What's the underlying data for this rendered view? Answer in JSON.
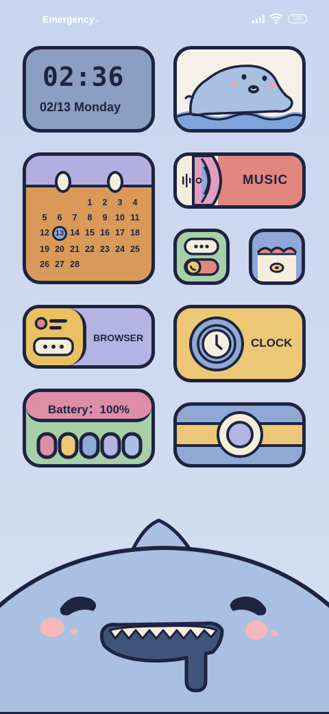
{
  "status_bar": {
    "carrier": "Emergency",
    "battery_level": "100",
    "icons": [
      "signal-icon",
      "wifi-icon",
      "battery-icon"
    ]
  },
  "clock_widget": {
    "time": "02:36",
    "date": "02/13 Monday"
  },
  "photo_widget": {
    "icon": "whale-illustration"
  },
  "calendar_widget": {
    "days": [
      "",
      "",
      "",
      "1",
      "2",
      "3",
      "4",
      "5",
      "6",
      "7",
      "8",
      "9",
      "10",
      "11",
      "12",
      "13",
      "14",
      "15",
      "16",
      "17",
      "18",
      "19",
      "20",
      "21",
      "22",
      "23",
      "24",
      "25",
      "26",
      "27",
      "28"
    ],
    "today": "13"
  },
  "music_widget": {
    "label": "MUSIC",
    "icon": "record-icon"
  },
  "small_apps": [
    {
      "icon": "phone-settings-icon"
    },
    {
      "icon": "gallery-icon"
    }
  ],
  "browser_widget": {
    "label": "BROWSER",
    "icon": "browser-icon"
  },
  "clock_app_widget": {
    "label": "CLOCK",
    "icon": "clock-face-icon"
  },
  "battery_widget": {
    "title": "Battery：100%",
    "level_percent": 100,
    "cells": 5
  },
  "camera_widget": {
    "icon": "camera-lens-icon"
  },
  "colors": {
    "outline": "#1d2340",
    "blue": "#8fa8d6",
    "lavender": "#b5b3e3",
    "orange": "#d99a59",
    "coral": "#e28680",
    "green": "#a7d0a9",
    "yellow": "#ecc776",
    "pink": "#df8ea7"
  }
}
